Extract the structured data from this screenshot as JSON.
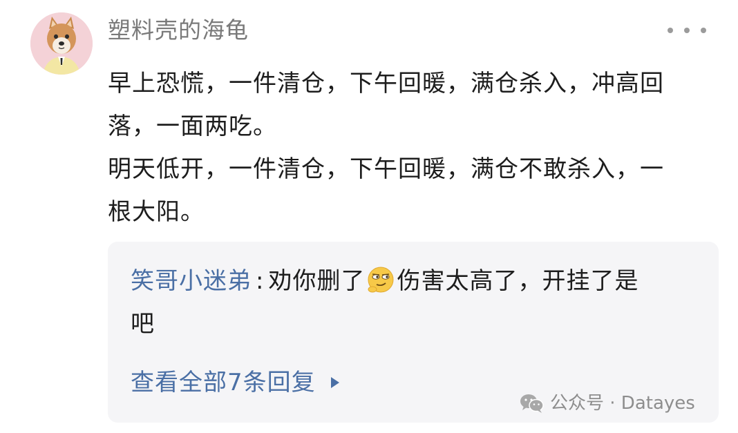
{
  "post": {
    "username": "塑料壳的海龟",
    "content_lines": [
      "早上恐慌，一件清仓，下午回暖，满仓杀入，冲高回",
      "落，一面两吃。",
      "明天低开，一件清仓，下午回暖，满仓不敢杀入，一",
      "根大阳。"
    ]
  },
  "reply": {
    "author": "笑哥小迷弟",
    "separator": ":",
    "text_before_emoji": "劝你删了",
    "emoji_icon": "smirk-emoji-icon",
    "text_after_emoji": "伤害太高了，开挂了是",
    "text_line2": "吧",
    "view_all_label": "查看全部7条回复"
  },
  "watermark": {
    "text": "公众号 · Datayes"
  },
  "colors": {
    "link": "#4a6fa5",
    "username": "#7a7a7a",
    "body_text": "#1d1d1d",
    "reply_bg": "#f5f5f7"
  }
}
